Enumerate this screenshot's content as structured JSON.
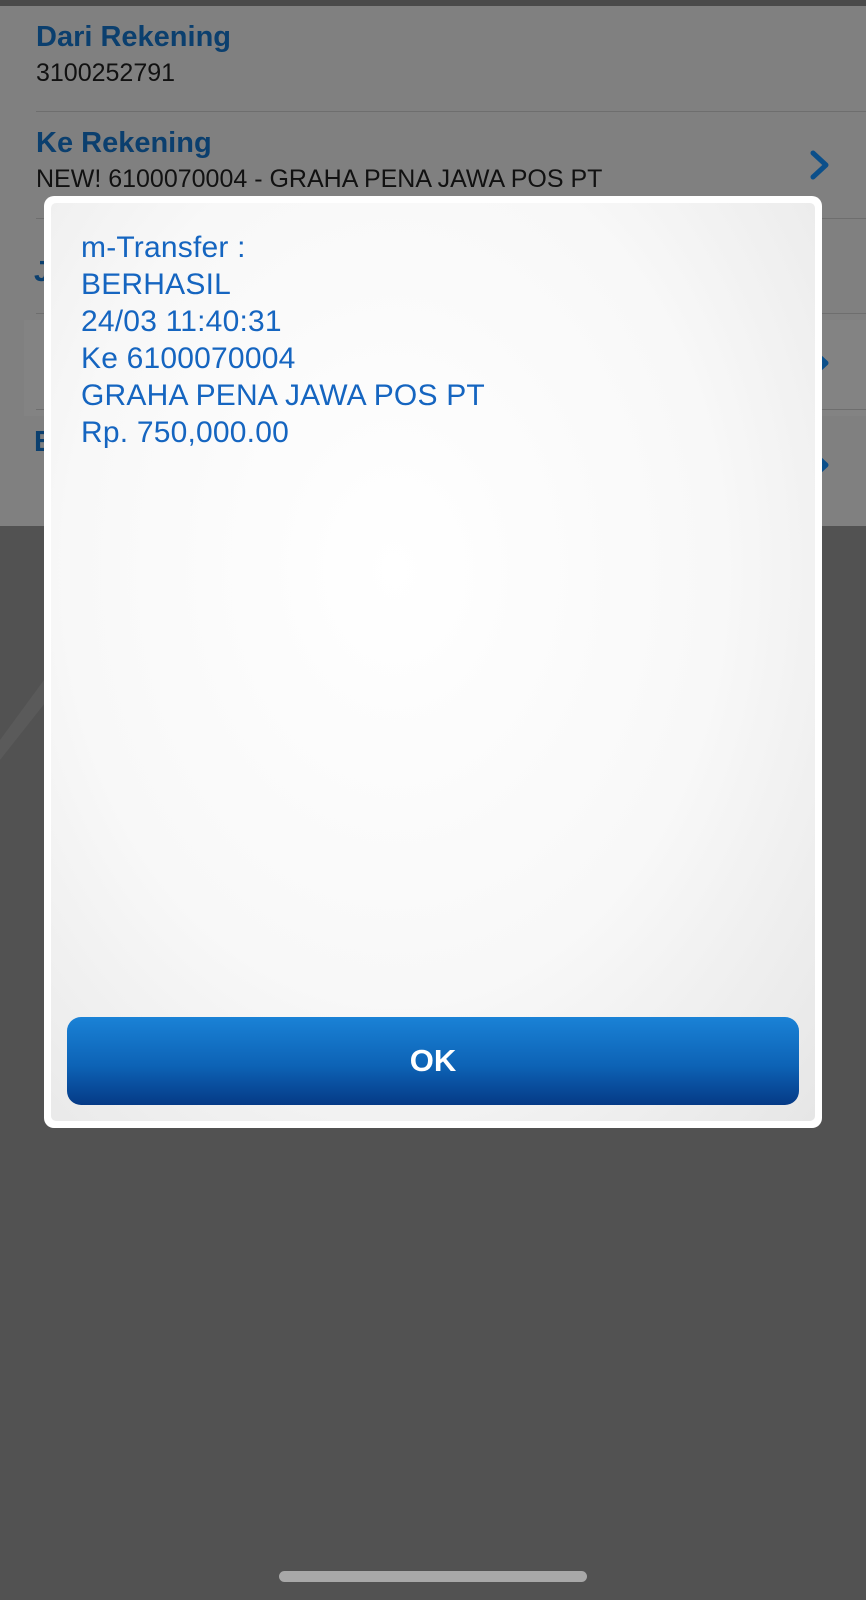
{
  "form": {
    "from_account": {
      "label": "Dari Rekening",
      "value": "3100252791"
    },
    "to_account": {
      "label": "Ke Rekening",
      "value": "NEW! 6100070004 - GRAHA PENA JAWA POS PT",
      "icon": "chevron-right-icon"
    },
    "hidden_rows": {
      "row3_initial": "J",
      "row5_initial": "B"
    }
  },
  "dialog": {
    "lines": [
      "m-Transfer :",
      "BERHASIL",
      "24/03 11:40:31",
      "Ke 6100070004",
      "GRAHA PENA JAWA POS PT",
      "Rp. 750,000.00"
    ],
    "ok_label": "OK"
  },
  "colors": {
    "label_blue": "#0b3f6e",
    "message_blue": "#1565c0",
    "button_top": "#1a82d6",
    "button_bottom": "#053a86",
    "overlay_bg": "#525252"
  }
}
